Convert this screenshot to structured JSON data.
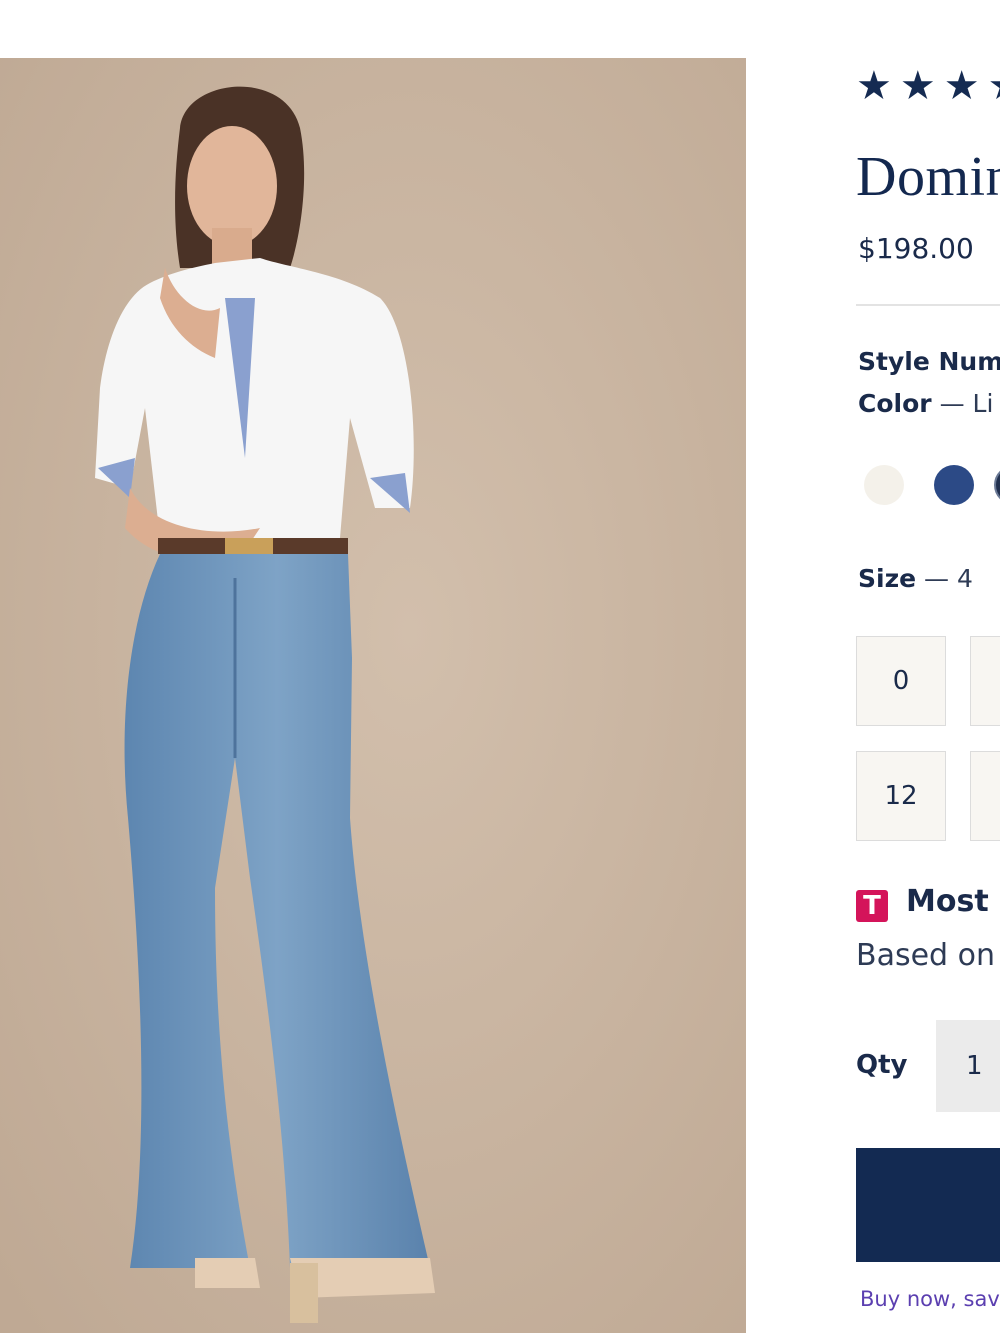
{
  "product": {
    "rating_stars": [
      "★",
      "★",
      "★",
      "★"
    ],
    "title": "Domin",
    "price": "$198.00",
    "style_number_label": "Style Num",
    "color_label": "Color",
    "color_value": "— Li",
    "size_label": "Size",
    "size_value": "— 4"
  },
  "swatches": [
    {
      "name": "cream",
      "color": "#f4f1ea"
    },
    {
      "name": "navy",
      "color": "#2c4a86"
    },
    {
      "name": "dark",
      "color": "#22314f"
    }
  ],
  "sizes": {
    "row1": [
      "0",
      ""
    ],
    "row2": [
      "12",
      ""
    ]
  },
  "fit": {
    "badge": "T",
    "title": "Most s",
    "note": "Based on"
  },
  "quantity": {
    "label": "Qty",
    "value": "1"
  },
  "purchase": {
    "add_button_label": "",
    "buy_now_note": "Buy now, sav"
  },
  "colors": {
    "brand_navy": "#132a52",
    "badge_pink": "#d4145a",
    "link_purple": "#5b3fb0",
    "photo_background": "#cdb9a6"
  }
}
